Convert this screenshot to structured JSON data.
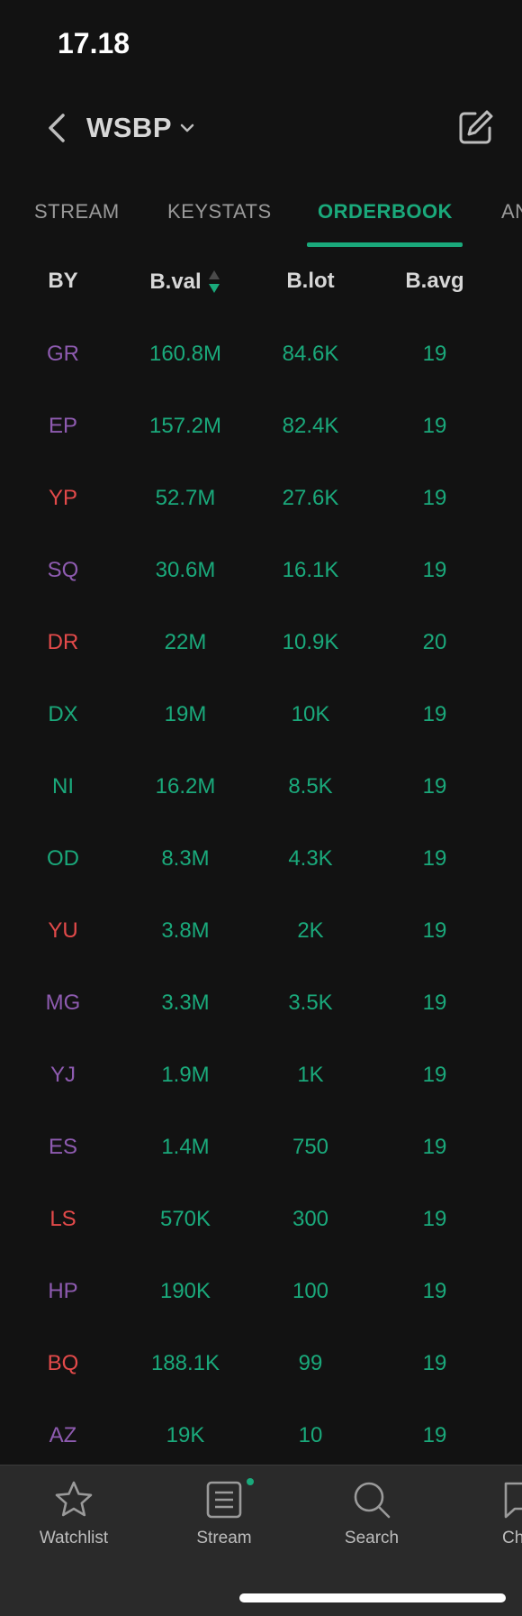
{
  "status_bar": {
    "time": "17.18"
  },
  "header": {
    "ticker": "WSBP"
  },
  "tabs": [
    {
      "label": "STREAM",
      "active": false
    },
    {
      "label": "KEYSTATS",
      "active": false
    },
    {
      "label": "ORDERBOOK",
      "active": true
    },
    {
      "label": "AN",
      "active": false
    }
  ],
  "table": {
    "columns": [
      "BY",
      "B.val",
      "B.lot",
      "B.avg"
    ],
    "rows": [
      {
        "by": "GR",
        "by_color": "purple",
        "bval": "160.8M",
        "blot": "84.6K",
        "bavg": "19"
      },
      {
        "by": "EP",
        "by_color": "purple",
        "bval": "157.2M",
        "blot": "82.4K",
        "bavg": "19"
      },
      {
        "by": "YP",
        "by_color": "red",
        "bval": "52.7M",
        "blot": "27.6K",
        "bavg": "19"
      },
      {
        "by": "SQ",
        "by_color": "purple",
        "bval": "30.6M",
        "blot": "16.1K",
        "bavg": "19"
      },
      {
        "by": "DR",
        "by_color": "red",
        "bval": "22M",
        "blot": "10.9K",
        "bavg": "20"
      },
      {
        "by": "DX",
        "by_color": "green",
        "bval": "19M",
        "blot": "10K",
        "bavg": "19"
      },
      {
        "by": "NI",
        "by_color": "green",
        "bval": "16.2M",
        "blot": "8.5K",
        "bavg": "19"
      },
      {
        "by": "OD",
        "by_color": "green",
        "bval": "8.3M",
        "blot": "4.3K",
        "bavg": "19"
      },
      {
        "by": "YU",
        "by_color": "red",
        "bval": "3.8M",
        "blot": "2K",
        "bavg": "19"
      },
      {
        "by": "MG",
        "by_color": "purple",
        "bval": "3.3M",
        "blot": "3.5K",
        "bavg": "19"
      },
      {
        "by": "YJ",
        "by_color": "purple",
        "bval": "1.9M",
        "blot": "1K",
        "bavg": "19"
      },
      {
        "by": "ES",
        "by_color": "purple",
        "bval": "1.4M",
        "blot": "750",
        "bavg": "19"
      },
      {
        "by": "LS",
        "by_color": "red",
        "bval": "570K",
        "blot": "300",
        "bavg": "19"
      },
      {
        "by": "HP",
        "by_color": "purple",
        "bval": "190K",
        "blot": "100",
        "bavg": "19"
      },
      {
        "by": "BQ",
        "by_color": "red",
        "bval": "188.1K",
        "blot": "99",
        "bavg": "19"
      },
      {
        "by": "AZ",
        "by_color": "purple",
        "bval": "19K",
        "blot": "10",
        "bavg": "19"
      }
    ]
  },
  "bottom_nav": [
    {
      "label": "Watchlist",
      "icon": "star-icon"
    },
    {
      "label": "Stream",
      "icon": "stream-icon"
    },
    {
      "label": "Search",
      "icon": "search-icon"
    },
    {
      "label": "Ch",
      "icon": "chat-icon"
    }
  ],
  "colors": {
    "accent": "#1aa97b",
    "purple": "#8e5bb0",
    "red": "#e34a4a",
    "background": "#121212",
    "nav_background": "#2a2a2a"
  }
}
